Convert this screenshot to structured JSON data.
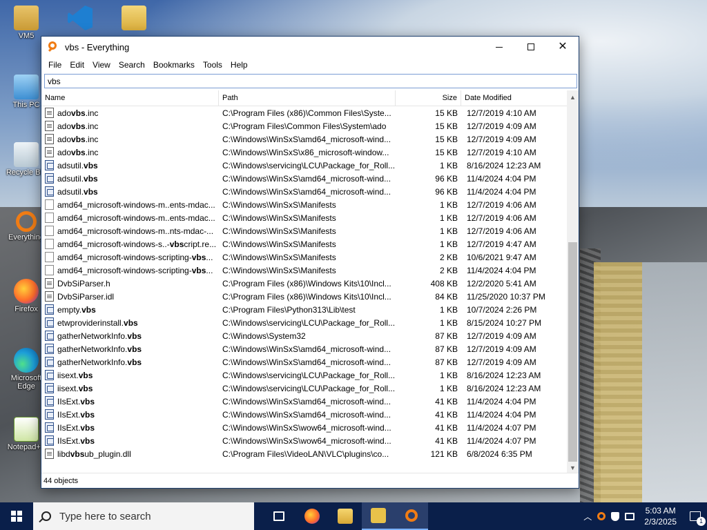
{
  "desktop": {
    "icons": [
      {
        "label": "VM5"
      },
      {
        "label": ""
      },
      {
        "label": ""
      },
      {
        "label": "This PC"
      },
      {
        "label": "Recycle Bin"
      },
      {
        "label": "Everything"
      },
      {
        "label": "Firefox"
      },
      {
        "label": "Microsoft Edge"
      },
      {
        "label": "Notepad++"
      }
    ]
  },
  "window": {
    "title": "vbs - Everything",
    "menu": [
      "File",
      "Edit",
      "View",
      "Search",
      "Bookmarks",
      "Tools",
      "Help"
    ],
    "search": {
      "value": "vbs"
    },
    "columns": {
      "name": "Name",
      "path": "Path",
      "size": "Size",
      "date": "Date Modified"
    },
    "rows": [
      {
        "icon": "doc",
        "pre": "ado",
        "hl": "vbs",
        "post": ".inc",
        "path": "C:\\Program Files (x86)\\Common Files\\Syste...",
        "size": "15 KB",
        "date": "12/7/2019 4:10 AM"
      },
      {
        "icon": "doc",
        "pre": "ado",
        "hl": "vbs",
        "post": ".inc",
        "path": "C:\\Program Files\\Common Files\\System\\ado",
        "size": "15 KB",
        "date": "12/7/2019 4:09 AM"
      },
      {
        "icon": "doc",
        "pre": "ado",
        "hl": "vbs",
        "post": ".inc",
        "path": "C:\\Windows\\WinSxS\\amd64_microsoft-wind...",
        "size": "15 KB",
        "date": "12/7/2019 4:09 AM"
      },
      {
        "icon": "doc",
        "pre": "ado",
        "hl": "vbs",
        "post": ".inc",
        "path": "C:\\Windows\\WinSxS\\x86_microsoft-window...",
        "size": "15 KB",
        "date": "12/7/2019 4:10 AM"
      },
      {
        "icon": "script",
        "pre": "adsutil.",
        "hl": "vbs",
        "post": "",
        "path": "C:\\Windows\\servicing\\LCU\\Package_for_Roll...",
        "size": "1 KB",
        "date": "8/16/2024 12:23 AM"
      },
      {
        "icon": "script",
        "pre": "adsutil.",
        "hl": "vbs",
        "post": "",
        "path": "C:\\Windows\\WinSxS\\amd64_microsoft-wind...",
        "size": "96 KB",
        "date": "11/4/2024 4:04 PM"
      },
      {
        "icon": "script",
        "pre": "adsutil.",
        "hl": "vbs",
        "post": "",
        "path": "C:\\Windows\\WinSxS\\amd64_microsoft-wind...",
        "size": "96 KB",
        "date": "11/4/2024 4:04 PM"
      },
      {
        "icon": "blank",
        "pre": "amd64_microsoft-windows-m..ents-mdac...",
        "hl": "",
        "post": "",
        "path": "C:\\Windows\\WinSxS\\Manifests",
        "size": "1 KB",
        "date": "12/7/2019 4:06 AM"
      },
      {
        "icon": "blank",
        "pre": "amd64_microsoft-windows-m..ents-mdac...",
        "hl": "",
        "post": "",
        "path": "C:\\Windows\\WinSxS\\Manifests",
        "size": "1 KB",
        "date": "12/7/2019 4:06 AM"
      },
      {
        "icon": "blank",
        "pre": "amd64_microsoft-windows-m..nts-mdac-...",
        "hl": "",
        "post": "",
        "path": "C:\\Windows\\WinSxS\\Manifests",
        "size": "1 KB",
        "date": "12/7/2019 4:06 AM"
      },
      {
        "icon": "blank",
        "pre": "amd64_microsoft-windows-s..-",
        "hl": "vbs",
        "post": "cript.re...",
        "path": "C:\\Windows\\WinSxS\\Manifests",
        "size": "1 KB",
        "date": "12/7/2019 4:47 AM"
      },
      {
        "icon": "blank",
        "pre": "amd64_microsoft-windows-scripting-",
        "hl": "vbs",
        "post": "...",
        "path": "C:\\Windows\\WinSxS\\Manifests",
        "size": "2 KB",
        "date": "10/6/2021 9:47 AM"
      },
      {
        "icon": "blank",
        "pre": "amd64_microsoft-windows-scripting-",
        "hl": "vbs",
        "post": "...",
        "path": "C:\\Windows\\WinSxS\\Manifests",
        "size": "2 KB",
        "date": "11/4/2024 4:04 PM"
      },
      {
        "icon": "doc",
        "pre": "DvbSiParser.h",
        "hl": "",
        "post": "",
        "path": "C:\\Program Files (x86)\\Windows Kits\\10\\Incl...",
        "size": "408 KB",
        "date": "12/2/2020 5:41 AM"
      },
      {
        "icon": "doc",
        "pre": "DvbSiParser.idl",
        "hl": "",
        "post": "",
        "path": "C:\\Program Files (x86)\\Windows Kits\\10\\Incl...",
        "size": "84 KB",
        "date": "11/25/2020 10:37 PM"
      },
      {
        "icon": "script",
        "pre": "empty.",
        "hl": "vbs",
        "post": "",
        "path": "C:\\Program Files\\Python313\\Lib\\test",
        "size": "1 KB",
        "date": "10/7/2024 2:26 PM"
      },
      {
        "icon": "script",
        "pre": "etwproviderinstall.",
        "hl": "vbs",
        "post": "",
        "path": "C:\\Windows\\servicing\\LCU\\Package_for_Roll...",
        "size": "1 KB",
        "date": "8/15/2024 10:27 PM"
      },
      {
        "icon": "script",
        "pre": "gatherNetworkInfo.",
        "hl": "vbs",
        "post": "",
        "path": "C:\\Windows\\System32",
        "size": "87 KB",
        "date": "12/7/2019 4:09 AM"
      },
      {
        "icon": "script",
        "pre": "gatherNetworkInfo.",
        "hl": "vbs",
        "post": "",
        "path": "C:\\Windows\\WinSxS\\amd64_microsoft-wind...",
        "size": "87 KB",
        "date": "12/7/2019 4:09 AM"
      },
      {
        "icon": "script",
        "pre": "gatherNetworkInfo.",
        "hl": "vbs",
        "post": "",
        "path": "C:\\Windows\\WinSxS\\amd64_microsoft-wind...",
        "size": "87 KB",
        "date": "12/7/2019 4:09 AM"
      },
      {
        "icon": "script",
        "pre": "iisext.",
        "hl": "vbs",
        "post": "",
        "path": "C:\\Windows\\servicing\\LCU\\Package_for_Roll...",
        "size": "1 KB",
        "date": "8/16/2024 12:23 AM"
      },
      {
        "icon": "script",
        "pre": "iisext.",
        "hl": "vbs",
        "post": "",
        "path": "C:\\Windows\\servicing\\LCU\\Package_for_Roll...",
        "size": "1 KB",
        "date": "8/16/2024 12:23 AM"
      },
      {
        "icon": "script",
        "pre": "IIsExt.",
        "hl": "vbs",
        "post": "",
        "path": "C:\\Windows\\WinSxS\\amd64_microsoft-wind...",
        "size": "41 KB",
        "date": "11/4/2024 4:04 PM"
      },
      {
        "icon": "script",
        "pre": "IIsExt.",
        "hl": "vbs",
        "post": "",
        "path": "C:\\Windows\\WinSxS\\amd64_microsoft-wind...",
        "size": "41 KB",
        "date": "11/4/2024 4:04 PM"
      },
      {
        "icon": "script",
        "pre": "IIsExt.",
        "hl": "vbs",
        "post": "",
        "path": "C:\\Windows\\WinSxS\\wow64_microsoft-wind...",
        "size": "41 KB",
        "date": "11/4/2024 4:07 PM"
      },
      {
        "icon": "script",
        "pre": "IIsExt.",
        "hl": "vbs",
        "post": "",
        "path": "C:\\Windows\\WinSxS\\wow64_microsoft-wind...",
        "size": "41 KB",
        "date": "11/4/2024 4:07 PM"
      },
      {
        "icon": "doc",
        "pre": "libd",
        "hl": "vbs",
        "post": "ub_plugin.dll",
        "path": "C:\\Program Files\\VideoLAN\\VLC\\plugins\\co...",
        "size": "121 KB",
        "date": "6/8/2024 6:35 PM"
      }
    ],
    "status": "44 objects"
  },
  "taskbar": {
    "search_placeholder": "Type here to search",
    "time": "5:03 AM",
    "date": "2/3/2025",
    "notification_count": "1"
  },
  "colors": {
    "accent": "#f07c14",
    "taskbar": "#0a1f4a",
    "selection_border": "#7a9cd3"
  }
}
